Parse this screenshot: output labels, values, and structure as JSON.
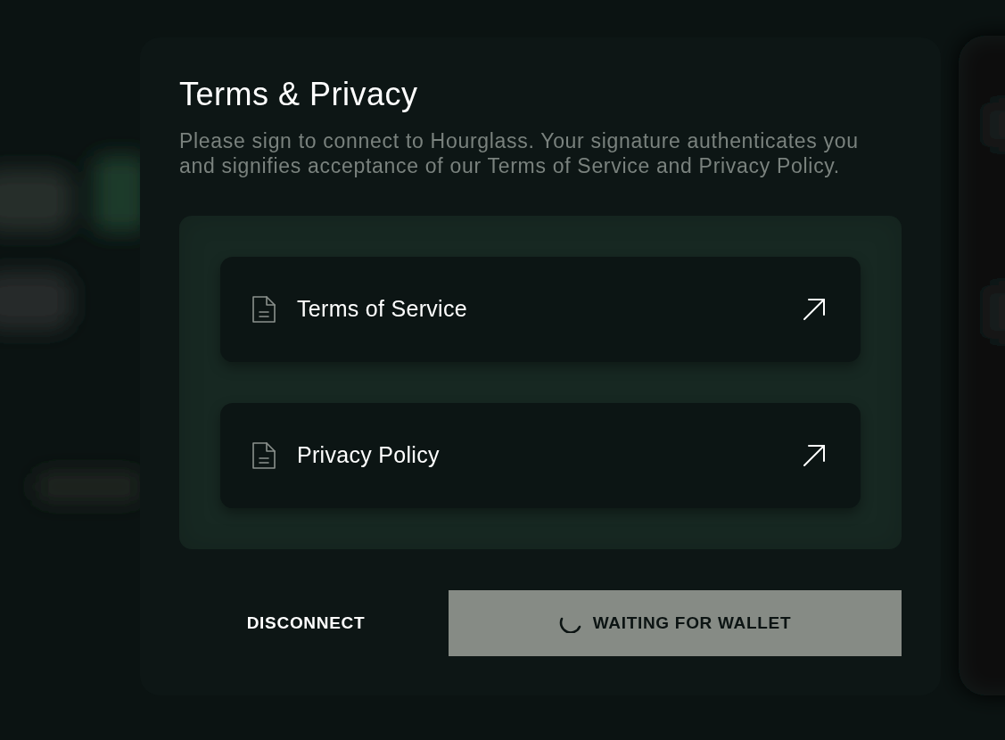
{
  "dialog": {
    "title": "Terms & Privacy",
    "description": "Please sign to connect to Hourglass. Your signature authenticates you and signifies acceptance of our Terms of Service and Privacy Policy.",
    "documents": [
      {
        "label": "Terms of Service"
      },
      {
        "label": "Privacy Policy"
      }
    ],
    "buttons": [
      {
        "kind": "text",
        "label": "DISCONNECT",
        "loading": false
      },
      {
        "kind": "filled",
        "label": "WAITING FOR WALLET",
        "loading": true
      }
    ]
  }
}
